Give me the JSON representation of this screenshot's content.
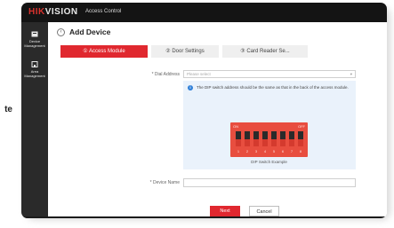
{
  "side_fragment": "te",
  "topbar": {
    "brand_red": "HIK",
    "brand_white": "VISION",
    "section": "Access Control"
  },
  "sidebar": {
    "items": [
      {
        "label_1": "Device",
        "label_2": "Management",
        "icon": "device-icon"
      },
      {
        "label_1": "Area",
        "label_2": "Management",
        "icon": "building-icon"
      }
    ]
  },
  "page": {
    "back_label": "‹",
    "title": "Add Device"
  },
  "steps": [
    {
      "label": "① Access Module",
      "active": true
    },
    {
      "label": "② Door Settings",
      "active": false
    },
    {
      "label": "③ Card Reader Se...",
      "active": false
    }
  ],
  "form": {
    "dial_address_label": "* Dial Address",
    "dial_address_placeholder": "Please select",
    "notice_text": "The DIP switch address should be the same as that in the back of the access module.",
    "dip": {
      "on_label": "ON",
      "off_label": "OFF",
      "numbers": [
        "1",
        "2",
        "3",
        "4",
        "5",
        "6",
        "7",
        "8"
      ],
      "caption": "DIP Switch Example"
    },
    "device_name_label": "* Device Name",
    "device_name_value": ""
  },
  "buttons": {
    "next": "Next",
    "cancel": "Cancel"
  },
  "colors": {
    "accent": "#e0282f",
    "topbar": "#141414",
    "sidebar": "#2a2a2a",
    "info": "#2f7fd8"
  }
}
